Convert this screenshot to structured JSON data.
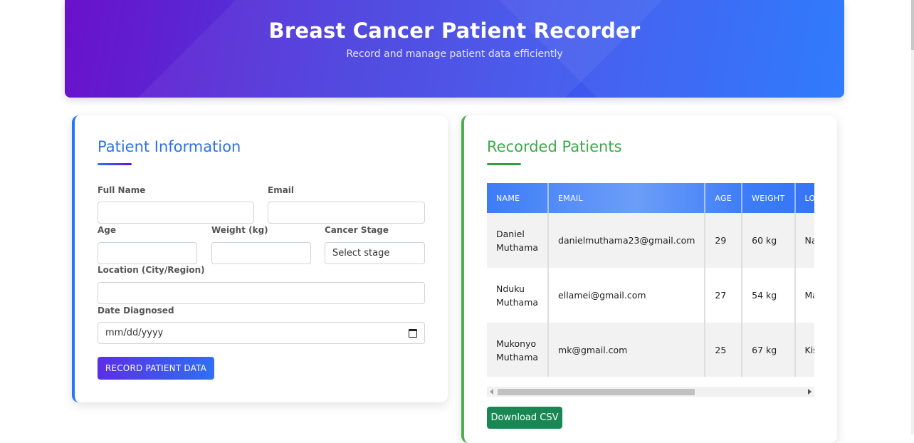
{
  "header": {
    "title": "Breast Cancer Patient Recorder",
    "subtitle": "Record and manage patient data efficiently"
  },
  "form": {
    "title": "Patient Information",
    "full_name_label": "Full Name",
    "full_name_value": "",
    "email_label": "Email",
    "email_value": "",
    "age_label": "Age",
    "age_value": "",
    "weight_label": "Weight (kg)",
    "weight_value": "",
    "stage_label": "Cancer Stage",
    "stage_selected": "Select stage",
    "location_label": "Location (City/Region)",
    "location_value": "",
    "date_label": "Date Diagnosed",
    "date_value": "mm/dd/yyyy",
    "submit_label": "RECORD PATIENT DATA"
  },
  "records": {
    "title": "Recorded Patients",
    "columns": [
      "NAME",
      "EMAIL",
      "AGE",
      "WEIGHT",
      "LOCATION"
    ],
    "rows": [
      {
        "name": "Daniel Muthama",
        "email": "danielmuthama23@gmail.com",
        "age": "29",
        "weight": "60 kg",
        "location": "Nairobi"
      },
      {
        "name": "Nduku Muthama",
        "email": "ellamei@gmail.com",
        "age": "27",
        "weight": "54 kg",
        "location": "Machakos"
      },
      {
        "name": "Mukonyo Muthama",
        "email": "mk@gmail.com",
        "age": "25",
        "weight": "67 kg",
        "location": "Kisumu"
      }
    ],
    "download_label": "Download CSV"
  },
  "colors": {
    "header_gradient_start": "#6a11cb",
    "header_gradient_end": "#2575fc",
    "form_accent": "#2575fc",
    "records_accent": "#4caf50",
    "download_button": "#198754"
  }
}
